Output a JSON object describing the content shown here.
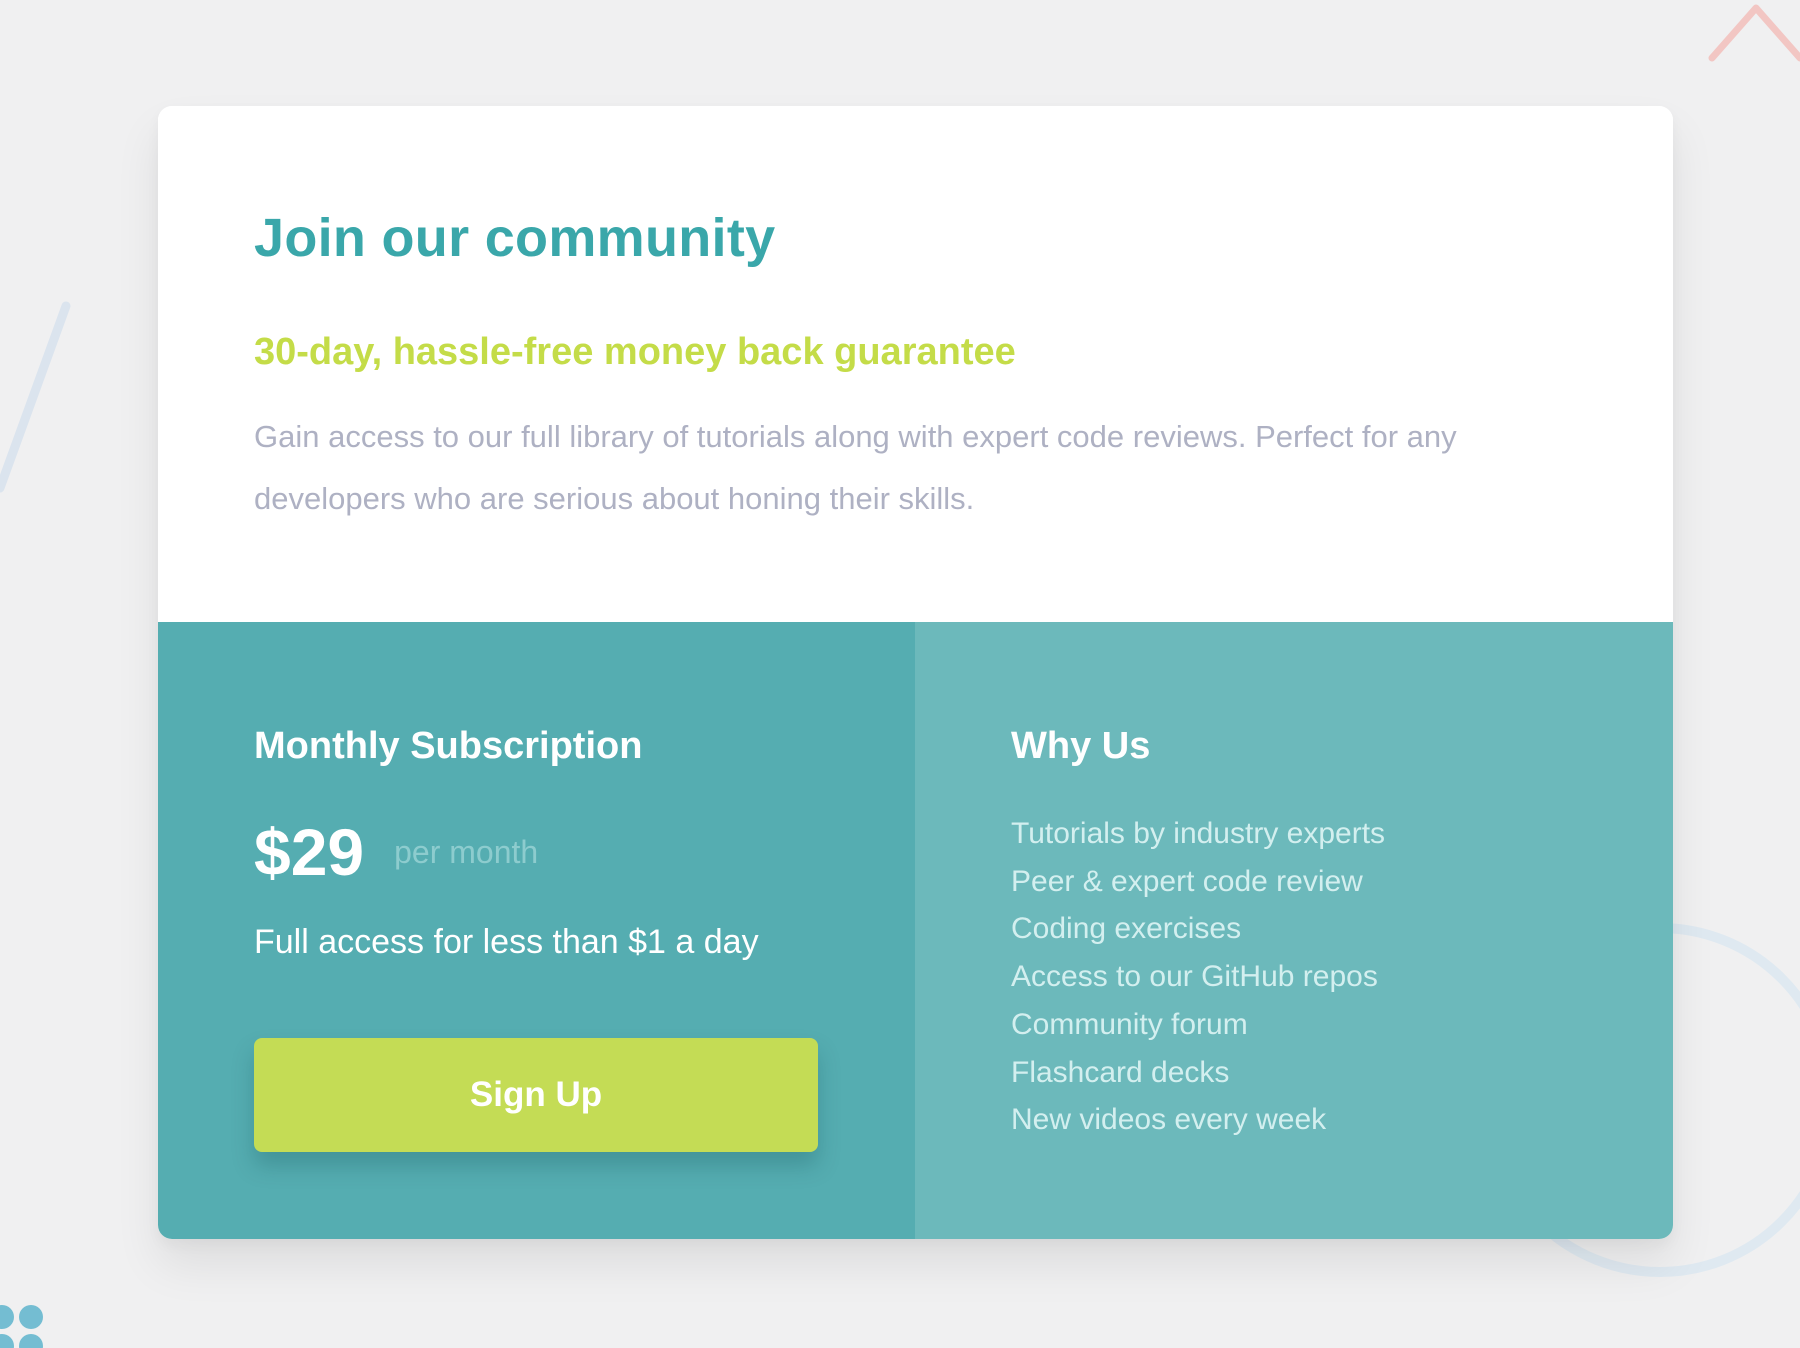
{
  "theme": {
    "page_background": "#f0f0f1",
    "card_background": "#ffffff",
    "title_color": "#3aa7aa",
    "subtitle_color": "#c4dc48",
    "description_color": "#aeb1c3",
    "subscription_background": "#55adb1",
    "why_us_background": "#6cb9bb",
    "button_background": "#c4dc55"
  },
  "card": {
    "title": "Join our community",
    "subtitle": "30-day, hassle-free money back guarantee",
    "description": "Gain access to our full library of tutorials along with expert code reviews. Perfect for any developers who are serious about honing their skills."
  },
  "subscription": {
    "title": "Monthly Subscription",
    "price": "$29",
    "period": "per month",
    "note": "Full access for less than $1 a day",
    "button_label": "Sign Up"
  },
  "why_us": {
    "title": "Why Us",
    "items": [
      "Tutorials by industry experts",
      "Peer & expert code review",
      "Coding exercises",
      "Access to our GitHub repos",
      "Community forum",
      "Flashcard decks",
      "New videos every week"
    ]
  }
}
